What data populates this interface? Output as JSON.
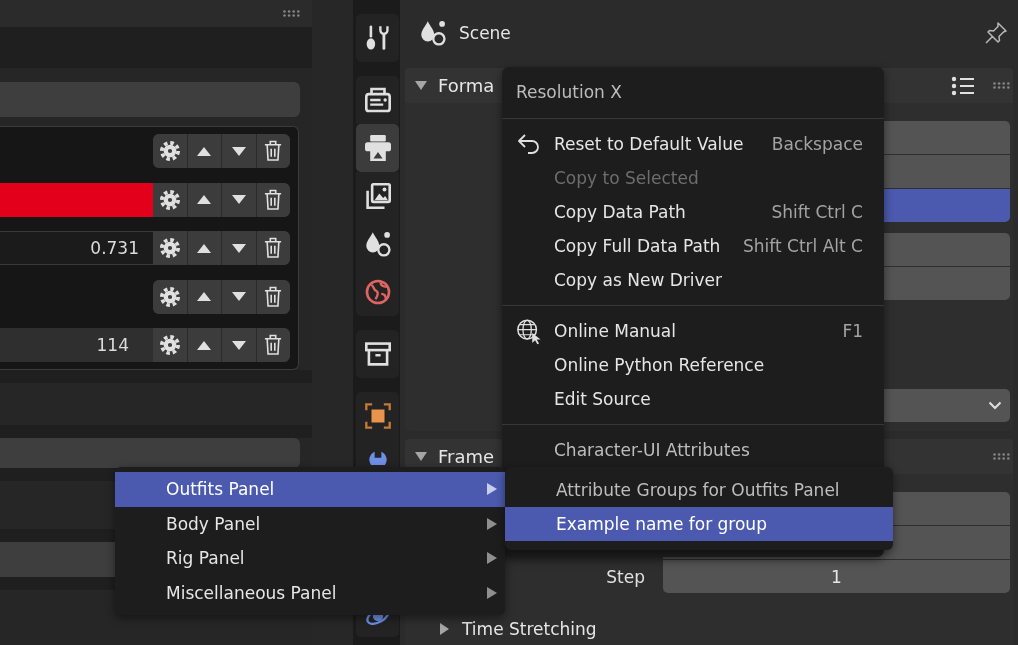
{
  "left_panel": {
    "list_rows": [
      {
        "kind": "blank"
      },
      {
        "kind": "color",
        "color": "#e3001b"
      },
      {
        "kind": "number",
        "value": "0.731"
      },
      {
        "kind": "blank"
      },
      {
        "kind": "integer",
        "value": "114"
      }
    ]
  },
  "properties": {
    "tab_groups": [
      {
        "tabs": [
          {
            "kind": "tool",
            "selected": false
          }
        ]
      },
      {
        "tabs": [
          {
            "kind": "render",
            "selected": false
          },
          {
            "kind": "output",
            "selected": true
          },
          {
            "kind": "view_layer",
            "selected": false
          },
          {
            "kind": "scene",
            "selected": false
          },
          {
            "kind": "world",
            "selected": false
          }
        ]
      },
      {
        "tabs": [
          {
            "kind": "collection",
            "selected": false
          }
        ]
      },
      {
        "tabs": [
          {
            "kind": "object",
            "selected": false
          },
          {
            "kind": "modifier",
            "selected": false
          }
        ]
      },
      {
        "tabs": [
          {
            "kind": "physics",
            "selected": false
          }
        ]
      }
    ],
    "header": {
      "title": "Scene"
    },
    "panels": [
      {
        "kind": "presets",
        "title": "Forma",
        "expanded": true,
        "field_groups": [
          {
            "fields": [
              {
                "kind": "field"
              },
              {
                "kind": "field"
              },
              {
                "kind": "slider",
                "level": 1
              }
            ]
          },
          {
            "fields": [
              {
                "kind": "field"
              },
              {
                "kind": "field"
              }
            ]
          },
          {
            "fields": [
              {
                "kind": "dropdown"
              }
            ]
          }
        ]
      },
      {
        "kind": "plain",
        "title": "Frame",
        "expanded": true,
        "field_groups": [
          {
            "fields": [
              {
                "kind": "field"
              },
              {
                "kind": "field"
              },
              {
                "kind": "field",
                "label": "Step",
                "value": "1"
              }
            ]
          }
        ],
        "subpanels": [
          {
            "title": "Time Stretching",
            "expanded": false
          }
        ]
      }
    ]
  },
  "context_menu": {
    "title": "Resolution X",
    "sections": [
      [
        {
          "kind": "reset",
          "label": "Reset to Default Value",
          "shortcut": "Backspace",
          "disabled": false
        },
        {
          "kind": "plain",
          "label": "Copy to Selected",
          "disabled": true
        },
        {
          "kind": "plain",
          "label": "Copy Data Path",
          "shortcut": "Shift Ctrl C",
          "disabled": false
        },
        {
          "kind": "plain",
          "label": "Copy Full Data Path",
          "shortcut": "Shift Ctrl Alt C",
          "disabled": false
        },
        {
          "kind": "plain",
          "label": "Copy as New Driver",
          "disabled": false
        }
      ],
      [
        {
          "kind": "manual",
          "label": "Online Manual",
          "shortcut": "F1",
          "disabled": false
        },
        {
          "kind": "plain",
          "label": "Online Python Reference",
          "disabled": false
        },
        {
          "kind": "plain",
          "label": "Edit Source",
          "disabled": false
        }
      ],
      [
        {
          "kind": "heading",
          "label": "Character-UI Attributes",
          "disabled": false
        }
      ]
    ]
  },
  "submenu": {
    "items": [
      {
        "label": "Outfits Panel",
        "selected": true
      },
      {
        "label": "Body Panel",
        "selected": false
      },
      {
        "label": "Rig Panel",
        "selected": false
      },
      {
        "label": "Miscellaneous Panel",
        "selected": false
      }
    ]
  },
  "nested_submenu": {
    "title": "Attribute Groups for Outfits Panel",
    "items": [
      {
        "label": "Example name for group",
        "selected": true
      }
    ]
  }
}
